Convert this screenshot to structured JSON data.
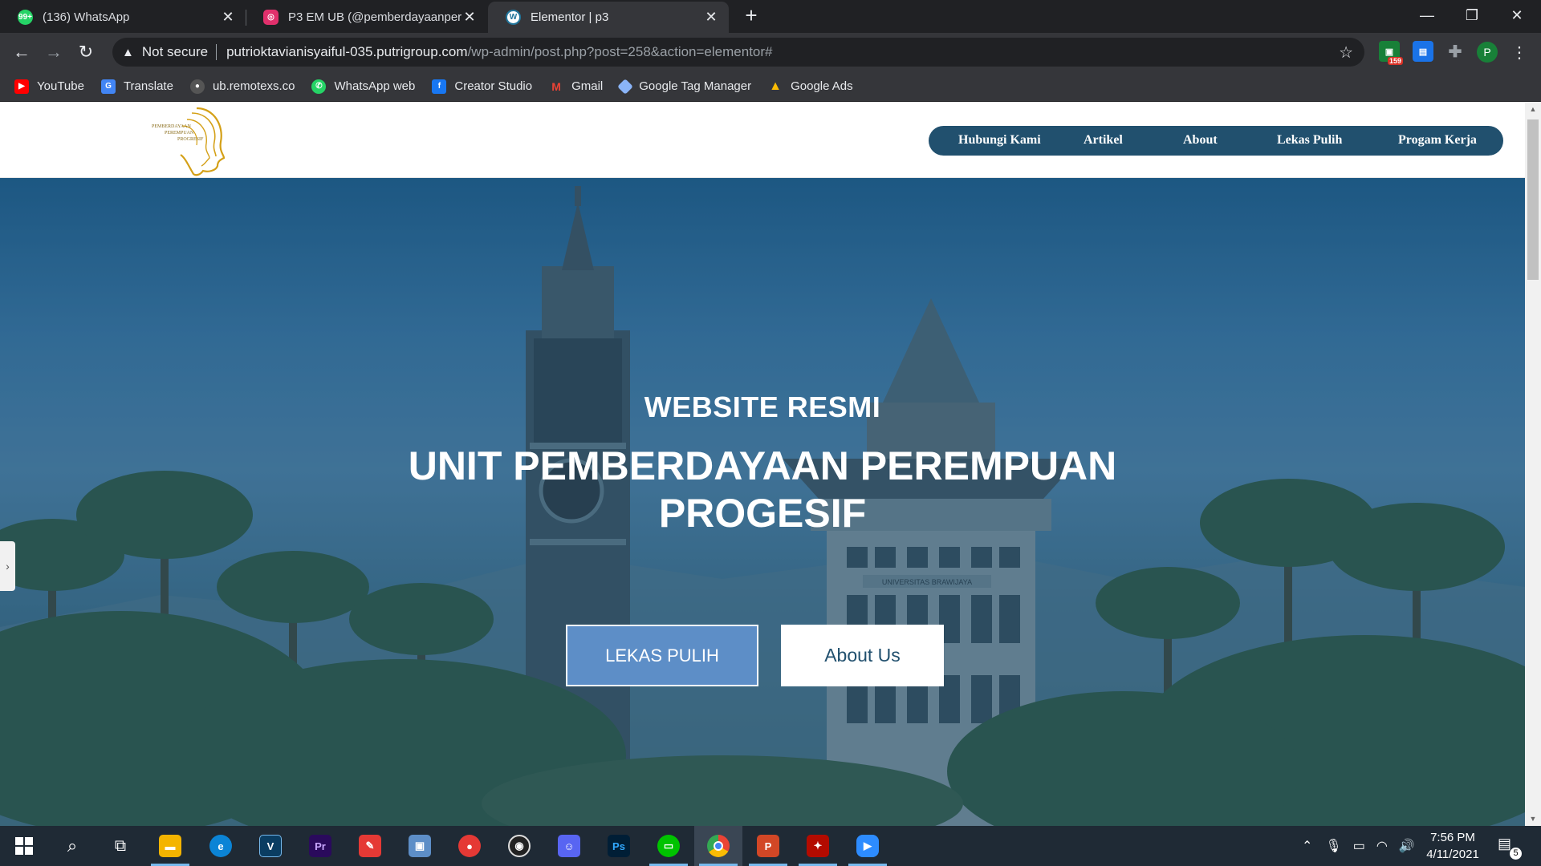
{
  "browser": {
    "tabs": [
      {
        "title": "(136) WhatsApp",
        "icon": "whatsapp-icon",
        "color": "#25d366"
      },
      {
        "title": "P3 EM UB (@pemberdayaanpere",
        "icon": "instagram-icon",
        "color": "#e1306c"
      },
      {
        "title": "Elementor | p3",
        "icon": "wordpress-icon",
        "color": "#21759b"
      }
    ],
    "close_glyph": "✕",
    "new_tab_glyph": "+",
    "address": {
      "security_label": "Not secure",
      "host": "putrioktavianisyaiful-035.putrigroup.com",
      "path": "/wp-admin/post.php?post=258&action=elementor#"
    },
    "extensions": [
      {
        "name": "extension-159-icon",
        "badge": "159",
        "color": "#188038"
      },
      {
        "name": "extension-meet-icon",
        "color": "#1a73e8"
      }
    ],
    "profile_initial": "P",
    "bookmarks": [
      {
        "label": "YouTube",
        "icon": "youtube-icon",
        "color": "#ff0000"
      },
      {
        "label": "Translate",
        "icon": "translate-icon",
        "color": "#4285f4"
      },
      {
        "label": "ub.remotexs.co",
        "icon": "remotexs-icon",
        "color": "#555555"
      },
      {
        "label": "WhatsApp web",
        "icon": "whatsapp-icon",
        "color": "#25d366"
      },
      {
        "label": "Creator Studio",
        "icon": "facebook-icon",
        "color": "#1877f2"
      },
      {
        "label": "Gmail",
        "icon": "gmail-icon",
        "color": "#ea4335"
      },
      {
        "label": "Google Tag Manager",
        "icon": "tag-manager-icon",
        "color": "#8ab4f8"
      },
      {
        "label": "Google Ads",
        "icon": "google-ads-icon",
        "color": "#fbbc04"
      }
    ]
  },
  "site": {
    "nav": [
      "Hubungi Kami",
      "Artikel",
      "About",
      "Lekas Pulih",
      "Progam Kerja"
    ],
    "logo_text": [
      "PEMBERDAYAAN",
      "PEREMPUAN",
      "PROGRESIF"
    ],
    "hero": {
      "subtitle": "WEBSITE RESMI",
      "title_line1": "UNIT PEMBERDAYAAN PEREMPUAN",
      "title_line2": "PROGESIF",
      "primary_button": "LEKAS PULIH",
      "secondary_button": "About Us"
    },
    "building_sign": "UNIVERSITAS BRAWIJAYA"
  },
  "taskbar": {
    "apps": [
      {
        "name": "file-explorer-icon",
        "color": "#f4b400"
      },
      {
        "name": "edge-icon",
        "color": "#0b84d6"
      },
      {
        "name": "vegas-icon",
        "color": "#0a3d62",
        "glyph": "V"
      },
      {
        "name": "premiere-icon",
        "color": "#2a0a5c",
        "glyph": "Pr"
      },
      {
        "name": "sketchbook-icon",
        "color": "#e53935"
      },
      {
        "name": "photos-icon",
        "color": "#5d8ec7"
      },
      {
        "name": "kinemaster-icon",
        "color": "#e53935"
      },
      {
        "name": "obs-icon",
        "color": "#222222"
      },
      {
        "name": "discord-icon",
        "color": "#5865f2"
      },
      {
        "name": "photoshop-icon",
        "color": "#001e36",
        "glyph": "Ps"
      },
      {
        "name": "line-icon",
        "color": "#00c300"
      },
      {
        "name": "chrome-icon",
        "color": "#4285f4"
      },
      {
        "name": "powerpoint-icon",
        "color": "#d24726",
        "glyph": "P"
      },
      {
        "name": "acrobat-icon",
        "color": "#b30b00"
      },
      {
        "name": "zoom-icon",
        "color": "#2d8cff"
      }
    ],
    "clock_time": "7:56 PM",
    "clock_date": "4/11/2021",
    "notification_count": "5"
  }
}
